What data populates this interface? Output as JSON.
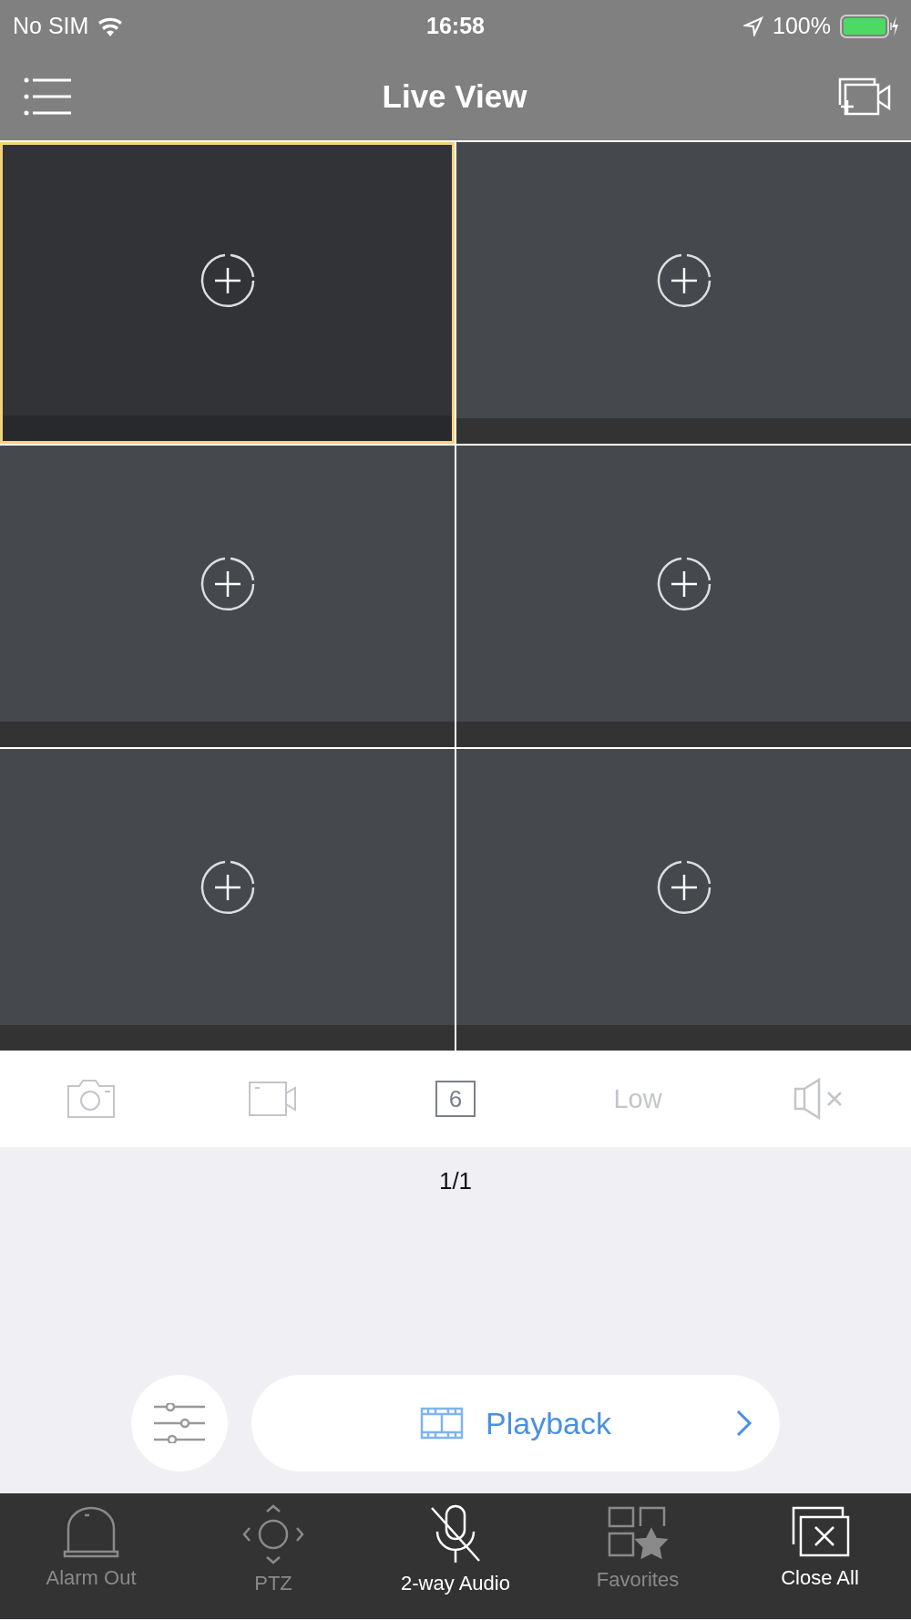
{
  "status_bar": {
    "carrier": "No SIM",
    "time": "16:58",
    "battery": "100%"
  },
  "header": {
    "title": "Live View"
  },
  "tiles": [
    {
      "selected": true
    },
    {
      "selected": false
    },
    {
      "selected": false
    },
    {
      "selected": false
    },
    {
      "selected": false
    },
    {
      "selected": false
    }
  ],
  "toolbar": {
    "window_count": "6",
    "quality": "Low"
  },
  "page_indicator": "1/1",
  "playback_button": {
    "label": "Playback"
  },
  "tab_bar": [
    {
      "kind": "alarm",
      "label": "Alarm Out",
      "disabled": true
    },
    {
      "kind": "ptz",
      "label": "PTZ",
      "disabled": true
    },
    {
      "kind": "audio",
      "label": "2-way Audio",
      "disabled": false
    },
    {
      "kind": "favorites",
      "label": "Favorites",
      "disabled": true
    },
    {
      "kind": "close",
      "label": "Close All",
      "disabled": false
    }
  ]
}
